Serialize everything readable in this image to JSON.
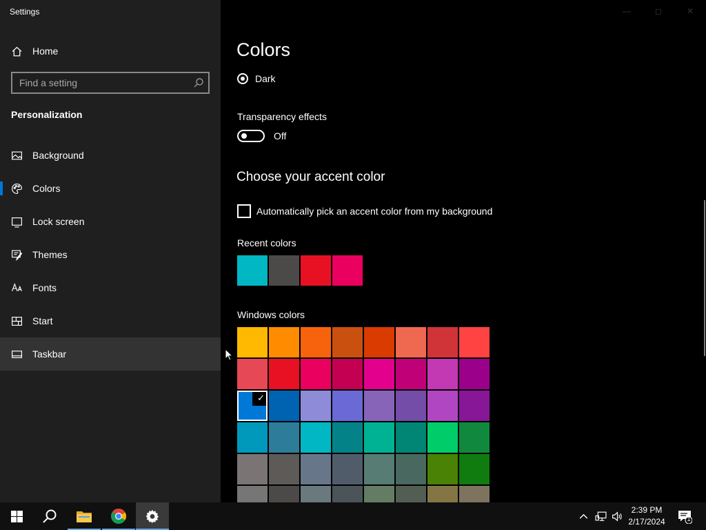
{
  "window": {
    "title": "Settings"
  },
  "sidebar": {
    "home_label": "Home",
    "search_placeholder": "Find a setting",
    "section_title": "Personalization",
    "items": [
      {
        "label": "Background",
        "icon": "image-icon"
      },
      {
        "label": "Colors",
        "icon": "palette-icon",
        "active": true
      },
      {
        "label": "Lock screen",
        "icon": "lock-screen-icon"
      },
      {
        "label": "Themes",
        "icon": "brush-icon"
      },
      {
        "label": "Fonts",
        "icon": "font-icon"
      },
      {
        "label": "Start",
        "icon": "start-layout-icon"
      },
      {
        "label": "Taskbar",
        "icon": "taskbar-icon",
        "hover": true
      }
    ]
  },
  "main": {
    "page_title": "Colors",
    "mode_option_label": "Dark",
    "transparency_label": "Transparency effects",
    "transparency_state": "Off",
    "accent_title": "Choose your accent color",
    "auto_pick_label": "Automatically pick an accent color from my background",
    "recent_label": "Recent colors",
    "recent_colors": [
      "#00b7c3",
      "#4c4a48",
      "#e81123",
      "#ea005e"
    ],
    "windows_label": "Windows colors",
    "windows_colors": [
      [
        "#ffb900",
        "#ff8c00",
        "#f7630c",
        "#ca5010",
        "#da3b01",
        "#ef6950",
        "#d13438",
        "#ff4343"
      ],
      [
        "#e74856",
        "#e81123",
        "#ea005e",
        "#c30052",
        "#e3008c",
        "#bf0077",
        "#c239b3",
        "#9a0089"
      ],
      [
        "#0078d7",
        "#0063b1",
        "#8e8cd8",
        "#6b69d6",
        "#8764b8",
        "#744da9",
        "#b146c2",
        "#881798"
      ],
      [
        "#0099bc",
        "#2d7d9a",
        "#00b7c3",
        "#038387",
        "#00b294",
        "#018574",
        "#00cc6a",
        "#10893e"
      ],
      [
        "#7a7574",
        "#5d5a58",
        "#68768a",
        "#515c6b",
        "#567c73",
        "#486860",
        "#498205",
        "#107c10"
      ],
      [
        "#767676",
        "#4c4a48",
        "#69797e",
        "#4a5459",
        "#647c64",
        "#525e54",
        "#847545",
        "#7e735f"
      ]
    ],
    "selected_color": "#0078d7"
  },
  "taskbar": {
    "time": "2:39 PM",
    "date": "2/17/2024",
    "notification_count": "1"
  }
}
